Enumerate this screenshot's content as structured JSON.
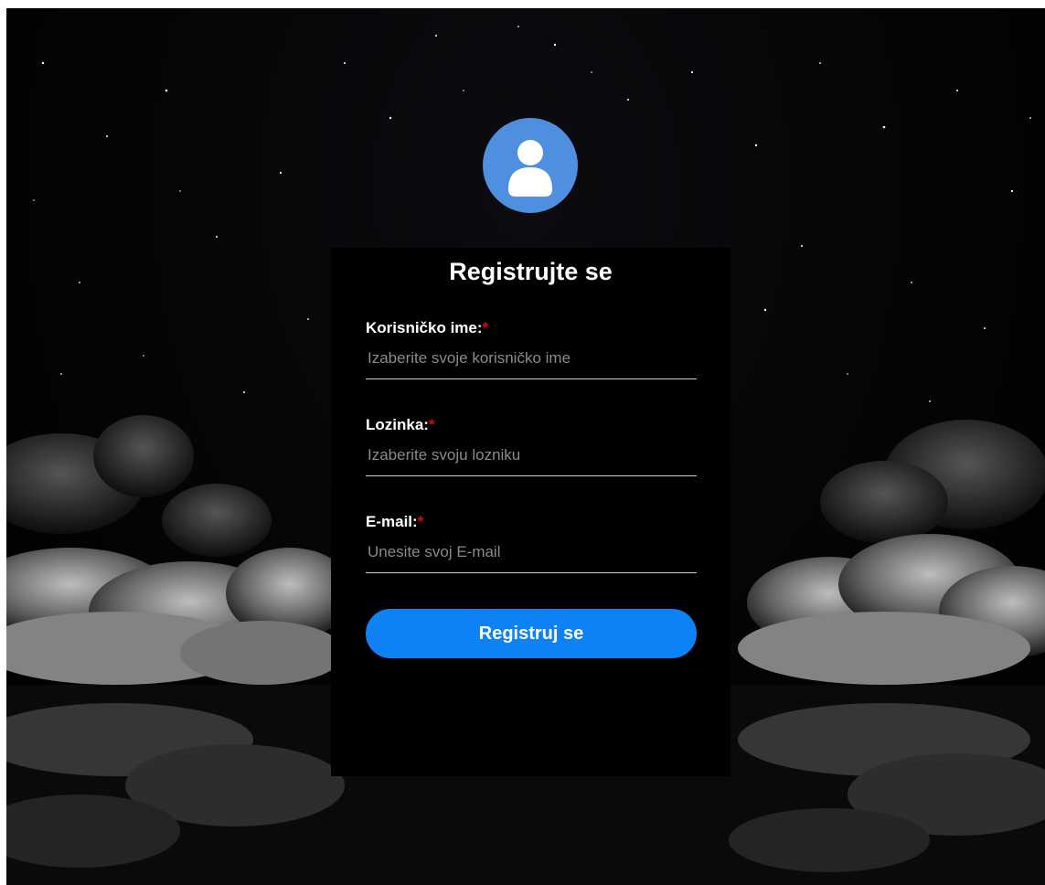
{
  "form": {
    "title": "Registrujte se",
    "fields": [
      {
        "label": "Korisničko ime:",
        "required_mark": "*",
        "placeholder": "Izaberite svoje korisničko ime",
        "value": ""
      },
      {
        "label": "Lozinka:",
        "required_mark": "*",
        "placeholder": "Izaberite svoju lozniku",
        "value": ""
      },
      {
        "label": "E-mail:",
        "required_mark": "*",
        "placeholder": "Unesite svoj E-mail",
        "value": ""
      }
    ],
    "submit_label": "Registruj se"
  },
  "icons": {
    "avatar": "user-avatar-icon"
  },
  "colors": {
    "accent": "#0e82f5",
    "avatar_bg": "#4f8fdf",
    "required": "#e0001a",
    "card_bg": "#000000"
  }
}
